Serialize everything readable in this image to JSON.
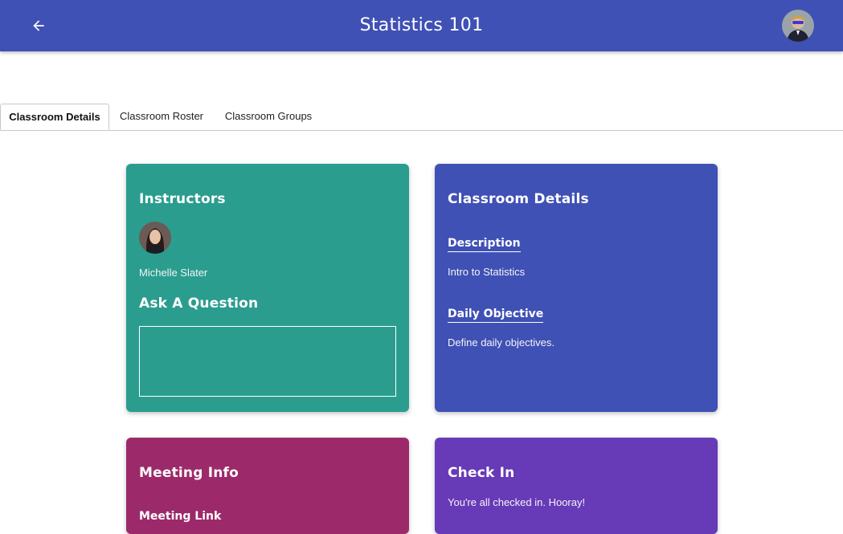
{
  "header": {
    "title": "Statistics 101",
    "back_icon": "arrow-left-icon",
    "avatar": "user-avatar"
  },
  "tabs": [
    {
      "label": "Classroom Details",
      "active": true
    },
    {
      "label": "Classroom Roster",
      "active": false
    },
    {
      "label": "Classroom Groups",
      "active": false
    }
  ],
  "cards": {
    "instructors": {
      "title": "Instructors",
      "color": "#2a9d8f",
      "instructor_name": "Michelle Slater",
      "ask_title": "Ask A Question",
      "question_value": ""
    },
    "details": {
      "title": "Classroom Details",
      "color": "#3f51b5",
      "description_label": "Description",
      "description_value": "Intro to Statistics",
      "objective_label": "Daily Objective",
      "objective_value": "Define daily objectives."
    },
    "meeting": {
      "title": "Meeting Info",
      "color": "#9c2a6a",
      "link_label": "Meeting Link"
    },
    "checkin": {
      "title": "Check In",
      "color": "#673ab7",
      "message": "You're all checked in. Hooray!"
    }
  }
}
